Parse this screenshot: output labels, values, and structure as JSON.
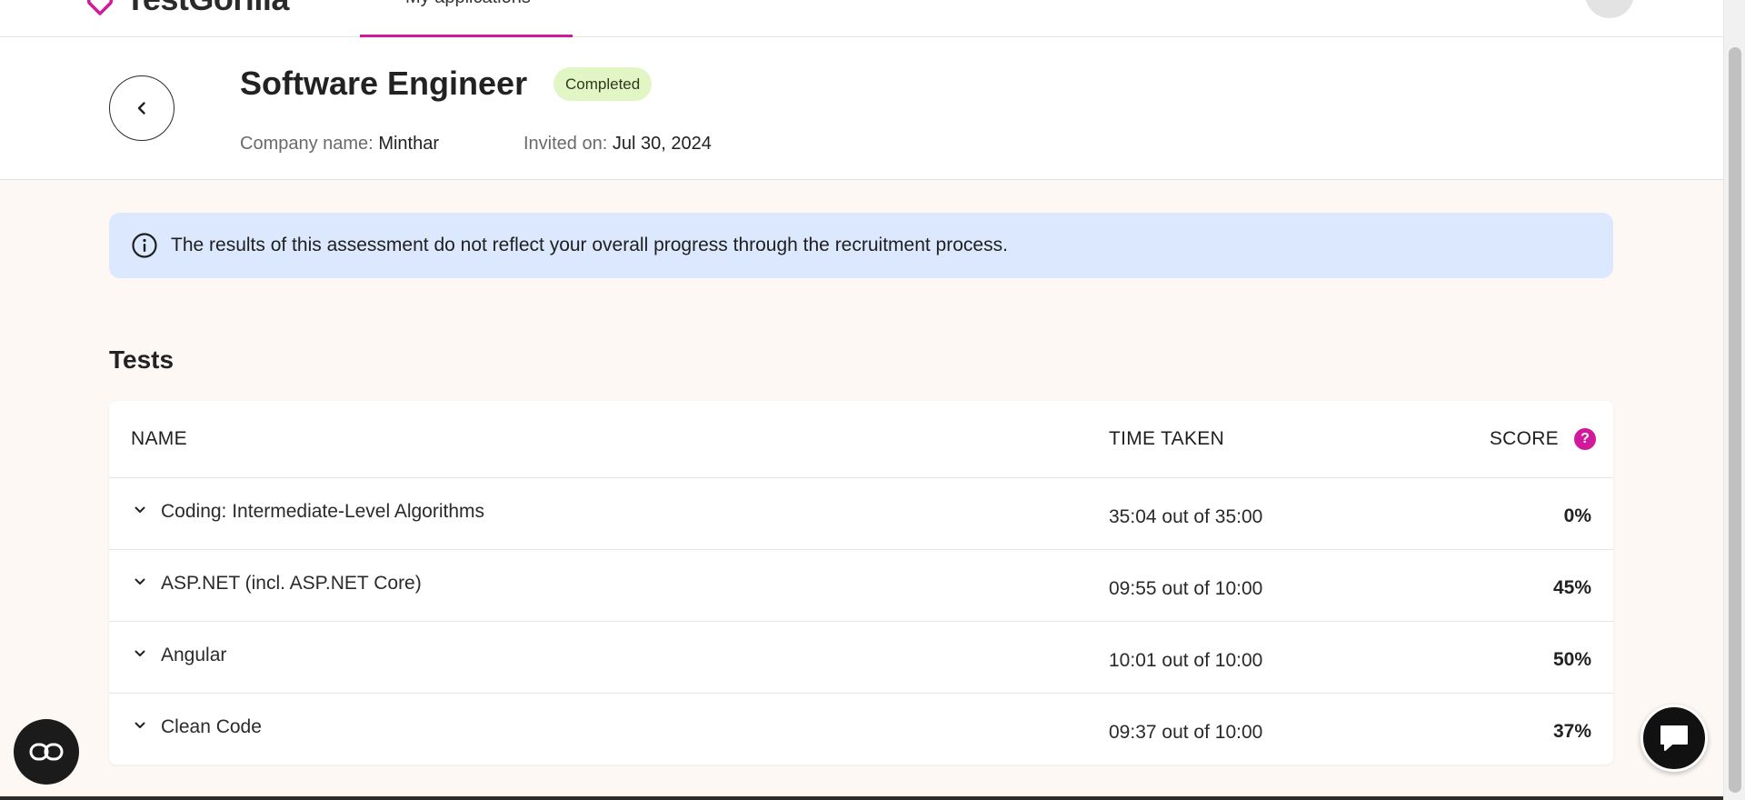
{
  "nav": {
    "logo_text": "TestGorilla",
    "active_tab": "My applications"
  },
  "header": {
    "title": "Software Engineer",
    "status": "Completed",
    "company_label": "Company name:",
    "company_value": "Minthar",
    "invited_label": "Invited on:",
    "invited_value": "Jul 30, 2024"
  },
  "banner": {
    "text": "The results of this assessment do not reflect your overall progress through the recruitment process."
  },
  "tests": {
    "title": "Tests",
    "columns": {
      "name": "NAME",
      "time": "TIME TAKEN",
      "score": "SCORE"
    },
    "rows": [
      {
        "name": "Coding: Intermediate-Level Algorithms",
        "time": "35:04 out of 35:00",
        "score": "0%"
      },
      {
        "name": "ASP.NET (incl. ASP.NET Core)",
        "time": "09:55 out of 10:00",
        "score": "45%"
      },
      {
        "name": "Angular",
        "time": "10:01 out of 10:00",
        "score": "50%"
      },
      {
        "name": "Clean Code",
        "time": "09:37 out of 10:00",
        "score": "37%"
      }
    ]
  },
  "colors": {
    "accent": "#d1199b",
    "badge_bg": "#e2f5c4",
    "banner_bg": "#dbe8fd",
    "page_bg": "#fdf8f4"
  },
  "icons": {
    "back": "chevron-left-icon",
    "info": "info-icon",
    "help": "question-icon",
    "expand": "chevron-down-icon",
    "accessibility": "accessibility-icon",
    "chat": "chat-icon"
  }
}
